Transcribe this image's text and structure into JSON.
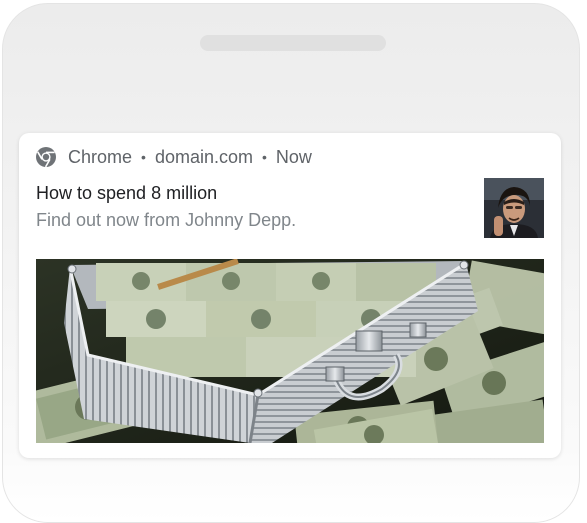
{
  "notification": {
    "app_name": "Chrome",
    "separator": "•",
    "domain": "domain.com",
    "time": "Now",
    "title": "How to spend 8 million",
    "body": "Find out now from Johnny Depp."
  },
  "icons": {
    "app": "chrome-icon"
  },
  "colors": {
    "frame": "#f0f0f0",
    "card": "#ffffff",
    "meta_text": "#5f6368",
    "title_text": "#202124",
    "body_text": "#80868b"
  }
}
